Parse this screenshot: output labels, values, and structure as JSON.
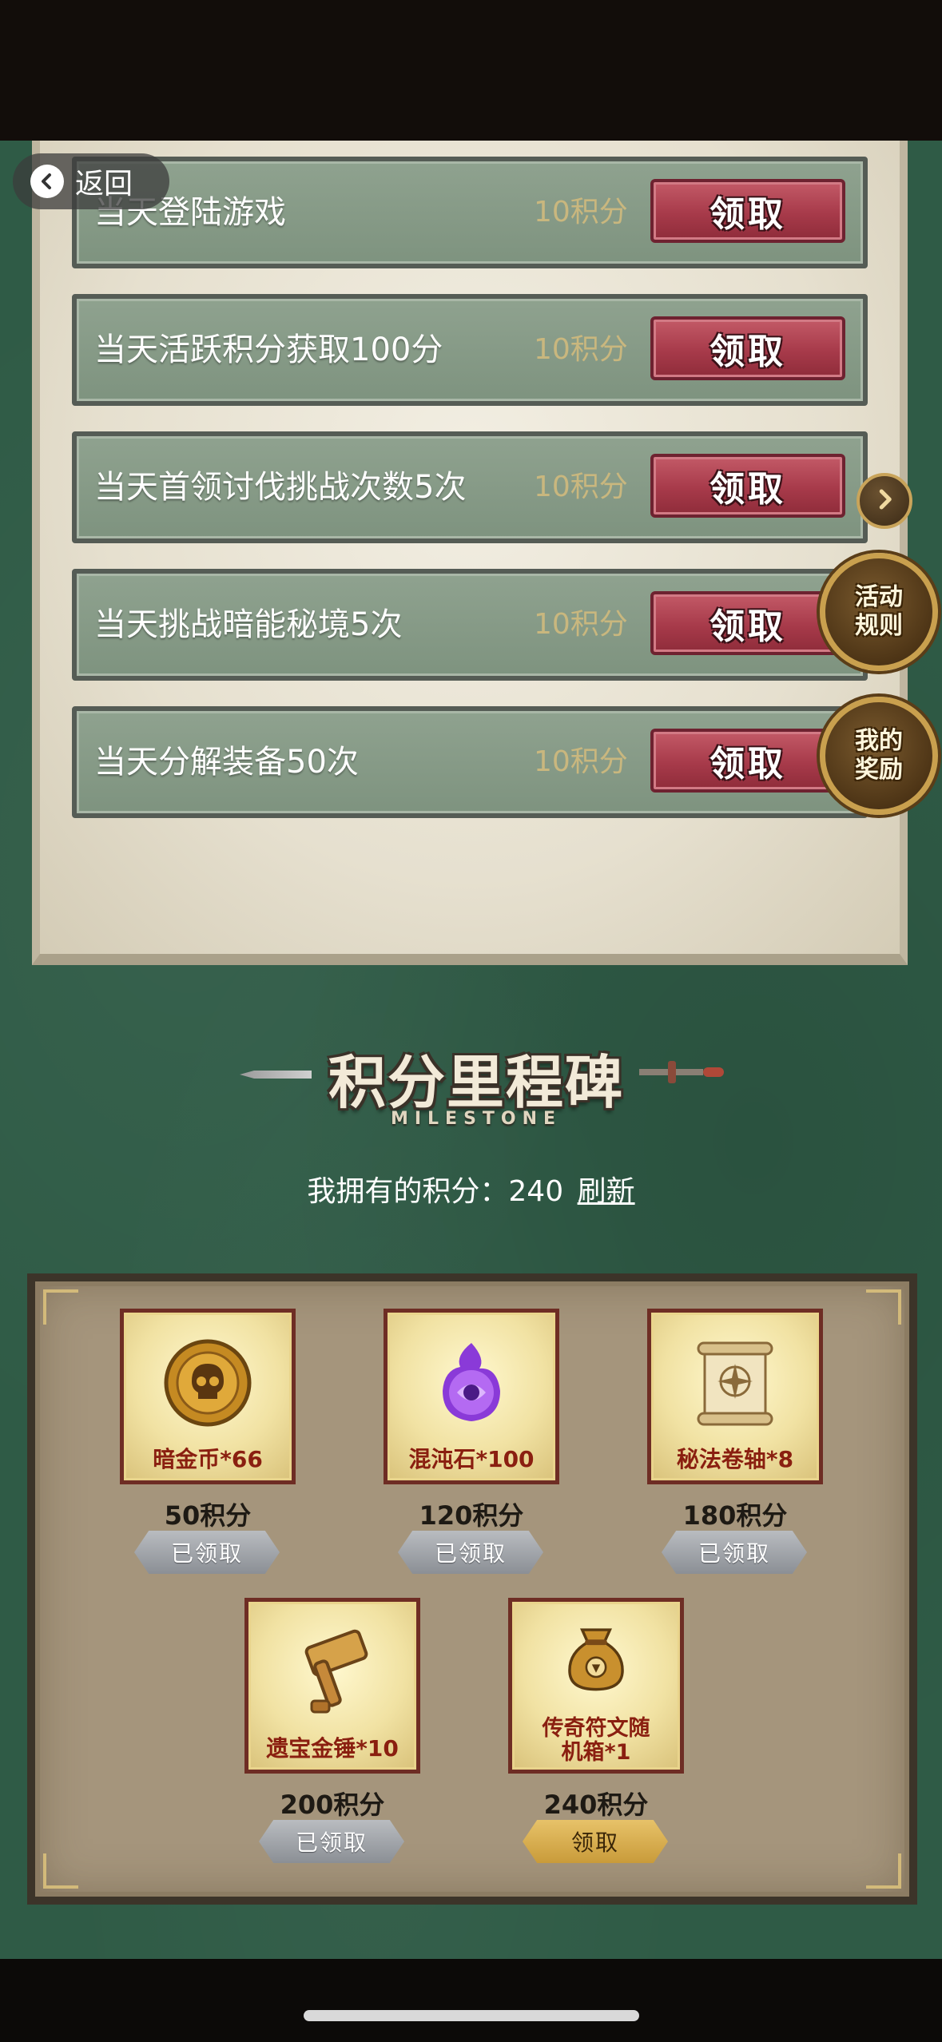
{
  "back": {
    "label": "返回"
  },
  "tasks": [
    {
      "label": "当天登陆游戏",
      "points": "10积分",
      "button": "领取"
    },
    {
      "label": "当天活跃积分获取100分",
      "points": "10积分",
      "button": "领取"
    },
    {
      "label": "当天首领讨伐挑战次数5次",
      "points": "10积分",
      "button": "领取"
    },
    {
      "label": "当天挑战暗能秘境5次",
      "points": "10积分",
      "button": "领取"
    },
    {
      "label": "当天分解装备50次",
      "points": "10积分",
      "button": "领取"
    }
  ],
  "side": {
    "rules_label": "活动规则",
    "rewards_label": "我的奖励"
  },
  "milestone": {
    "title": "积分里程碑",
    "subtitle": "MILESTONE"
  },
  "points_line": {
    "label": "我拥有的积分：",
    "value": "240",
    "refresh": "刷新"
  },
  "rewards": [
    {
      "name": "暗金币*66",
      "cost": "50积分",
      "button": "已领取",
      "state": "claimed",
      "icon": "skull-coin-icon"
    },
    {
      "name": "混沌石*100",
      "cost": "120积分",
      "button": "已领取",
      "state": "claimed",
      "icon": "chaos-stone-icon"
    },
    {
      "name": "秘法卷轴*8",
      "cost": "180积分",
      "button": "已领取",
      "state": "claimed",
      "icon": "scroll-icon"
    },
    {
      "name": "遗宝金锤*10",
      "cost": "200积分",
      "button": "已领取",
      "state": "claimed",
      "icon": "golden-hammer-icon"
    },
    {
      "name": "传奇符文随机箱*1",
      "cost": "240积分",
      "button": "领取",
      "state": "claimable",
      "icon": "rune-bag-icon"
    }
  ],
  "colors": {
    "background_green": "#2f5b46",
    "claim_red": "#a73a4a",
    "points_gold": "#c9b77e",
    "claimed_gray": "#8b8f95",
    "claimable_gold": "#c99b3a"
  }
}
